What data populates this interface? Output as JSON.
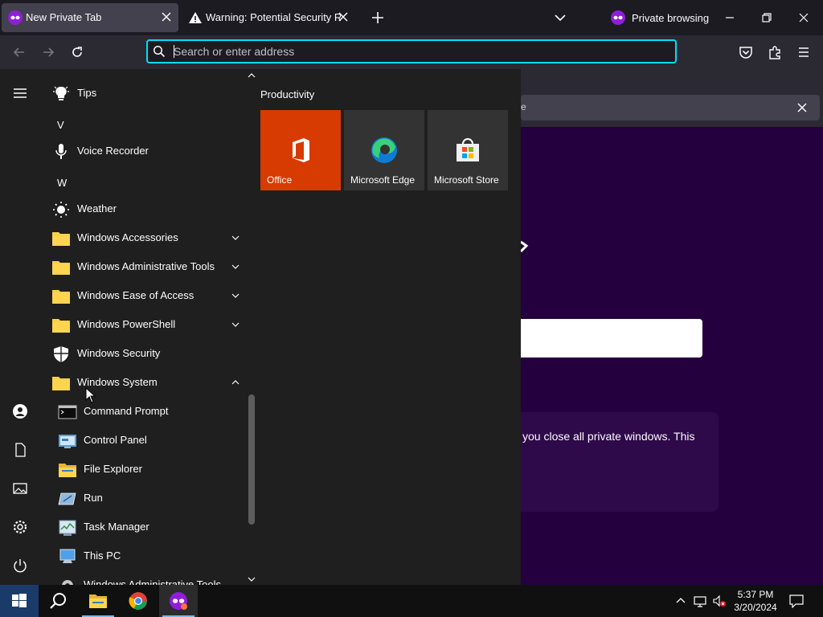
{
  "browser": {
    "tabs": [
      {
        "title": "New Private Tab",
        "active": true
      },
      {
        "title": "Warning: Potential Security Risk Ahead",
        "active": false
      }
    ],
    "private_indicator": "Private browsing",
    "url_placeholder": "Search or enter address",
    "accent_color": "#00ddff",
    "private_bg_color": "#25003e"
  },
  "page": {
    "notice_fragment": "e",
    "body_fragment": "you close all private windows. This"
  },
  "start_menu": {
    "apps": [
      {
        "label": "Tips",
        "icon": "lightbulb-icon"
      },
      {
        "letter": "V"
      },
      {
        "label": "Voice Recorder",
        "icon": "microphone-icon"
      },
      {
        "letter": "W"
      },
      {
        "label": "Weather",
        "icon": "sun-icon"
      },
      {
        "label": "Windows Accessories",
        "icon": "folder-icon",
        "expand": "down"
      },
      {
        "label": "Windows Administrative Tools",
        "icon": "folder-icon",
        "expand": "down"
      },
      {
        "label": "Windows Ease of Access",
        "icon": "folder-icon",
        "expand": "down"
      },
      {
        "label": "Windows PowerShell",
        "icon": "folder-icon",
        "expand": "down"
      },
      {
        "label": "Windows Security",
        "icon": "shield-icon"
      },
      {
        "label": "Windows System",
        "icon": "folder-icon",
        "expand": "up"
      }
    ],
    "system_items": [
      {
        "label": "Command Prompt",
        "icon": "terminal-icon"
      },
      {
        "label": "Control Panel",
        "icon": "control-panel-icon"
      },
      {
        "label": "File Explorer",
        "icon": "file-explorer-icon"
      },
      {
        "label": "Run",
        "icon": "run-icon"
      },
      {
        "label": "Task Manager",
        "icon": "task-manager-icon"
      },
      {
        "label": "This PC",
        "icon": "computer-icon"
      },
      {
        "label": "Windows Administrative Tools",
        "icon": "admin-tools-icon"
      }
    ],
    "tile_group": "Productivity",
    "tiles": [
      {
        "label": "Office",
        "icon": "office-icon",
        "color": "#d83b01"
      },
      {
        "label": "Microsoft Edge",
        "icon": "edge-icon"
      },
      {
        "label": "Microsoft Store",
        "icon": "store-icon"
      }
    ]
  },
  "taskbar": {
    "time": "5:37 PM",
    "date": "3/20/2024"
  }
}
